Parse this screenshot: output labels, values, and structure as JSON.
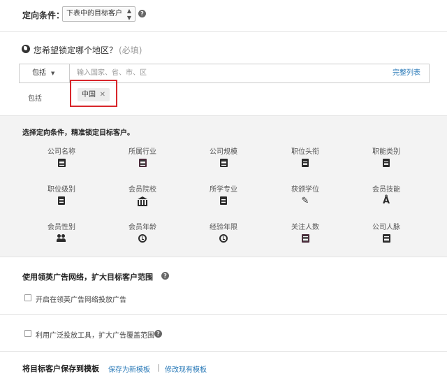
{
  "targeting": {
    "label": "定向条件：",
    "select_value": "下表中的目标客户",
    "help": "?"
  },
  "region": {
    "question": "您希望锁定哪个地区？",
    "required": "(必填)",
    "include_dropdown": "包括",
    "placeholder": "输入国家、省、市、区",
    "full_list_link": "完整列表",
    "include_label": "包括",
    "tags": [
      "中国"
    ],
    "tag_remove": "✕"
  },
  "criteria": {
    "title": "选择定向条件，精准锁定目标客户。",
    "items": [
      {
        "label": "公司名称",
        "icon": "building-icon"
      },
      {
        "label": "所属行业",
        "icon": "building-icon"
      },
      {
        "label": "公司规模",
        "icon": "building-icon"
      },
      {
        "label": "职位头衔",
        "icon": "document-icon"
      },
      {
        "label": "职能类别",
        "icon": "document-icon"
      },
      {
        "label": "职位级别",
        "icon": "document-icon"
      },
      {
        "label": "会员院校",
        "icon": "bank-icon"
      },
      {
        "label": "所学专业",
        "icon": "document-icon"
      },
      {
        "label": "获颁学位",
        "icon": "tool-icon"
      },
      {
        "label": "会员技能",
        "icon": "compass-icon"
      },
      {
        "label": "会员性别",
        "icon": "people-icon"
      },
      {
        "label": "会员年龄",
        "icon": "clock-icon"
      },
      {
        "label": "经验年限",
        "icon": "clock-icon"
      },
      {
        "label": "关注人数",
        "icon": "building-icon"
      },
      {
        "label": "公司人脉",
        "icon": "building-icon"
      }
    ]
  },
  "ads_network": {
    "title": "使用领英广告网络，扩大目标客户范围",
    "help": "?",
    "checkbox_label": "开启在领英广告网络投放广告",
    "checked": false
  },
  "expansion": {
    "checkbox_label": "利用广泛投放工具，扩大广告覆盖范围",
    "help": "?",
    "checked": false
  },
  "save_template": {
    "title": "将目标客户保存到模板",
    "save_new": "保存为新模板",
    "separator": "|",
    "modify_existing": "修改现有模板"
  }
}
